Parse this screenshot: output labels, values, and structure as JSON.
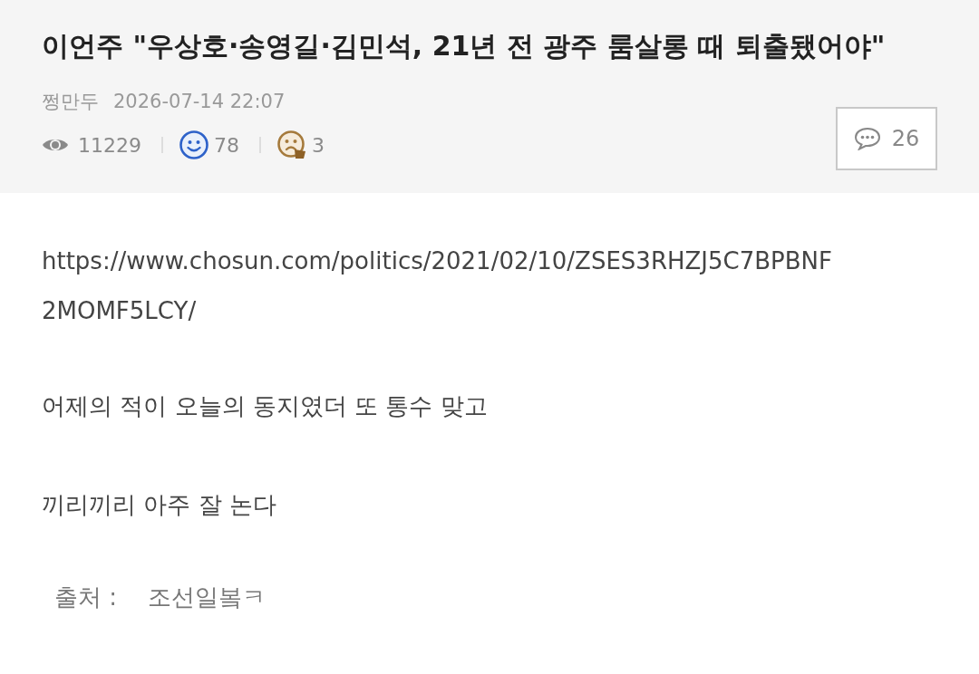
{
  "post": {
    "title": "이언주 \"우상호·송영길·김민석, 21년 전 광주 룸살롱 때 퇴출됐어야\"",
    "author": "쩡만두",
    "date": "2026-07-14 22:07"
  },
  "stats": [
    {
      "kind": "views",
      "count": "11229"
    },
    {
      "kind": "likes",
      "count": "78"
    },
    {
      "kind": "dislikes",
      "count": "3"
    }
  ],
  "comments_button": {
    "count": "26"
  },
  "body": [
    {
      "kind": "url",
      "text": "https://www.chosun.com/politics/2021/02/10/ZSES3RHZJ5C7BPBNF2MOMF5LCY/"
    },
    {
      "kind": "text",
      "text": "어제의 적이 오늘의 동지였더 또 통수 맞고"
    },
    {
      "kind": "text",
      "text": "끼리끼리 아주 잘 논다"
    }
  ],
  "source": {
    "label": "출처 :",
    "value": "조선일봌ㅋ"
  }
}
